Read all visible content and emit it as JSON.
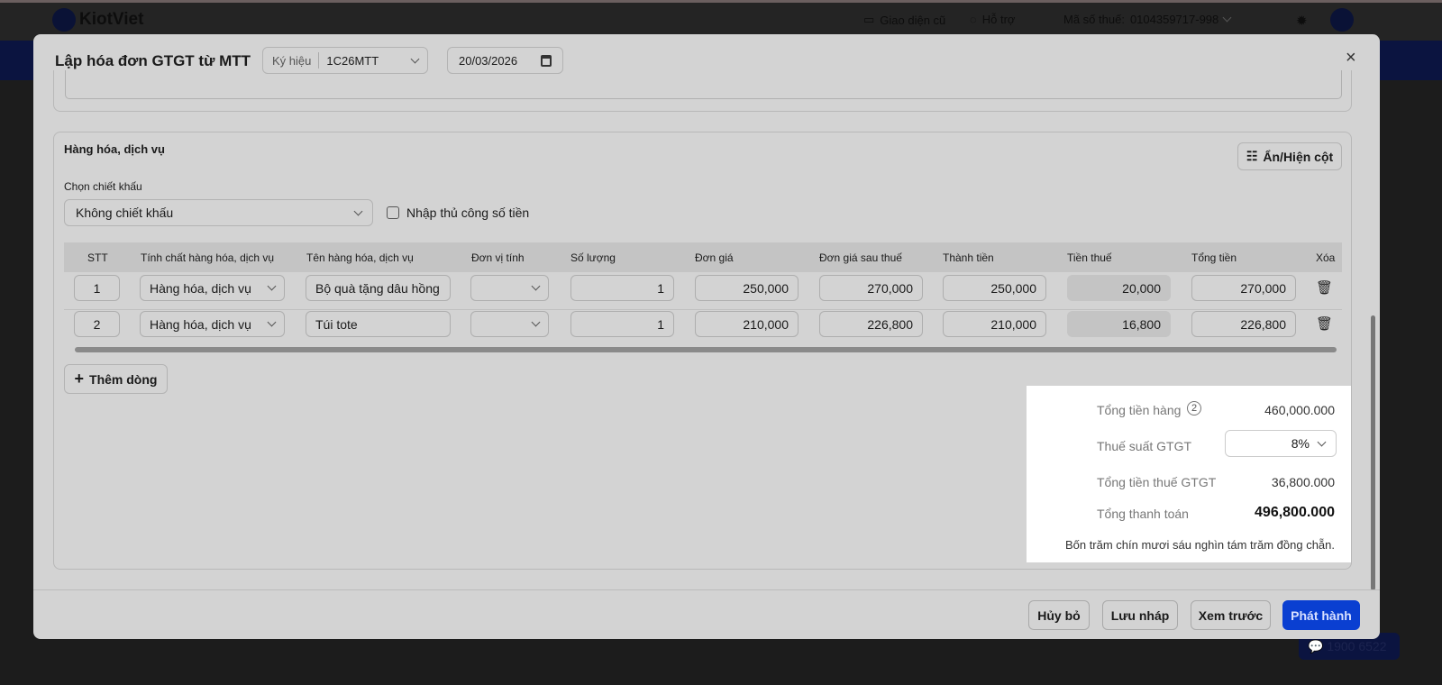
{
  "topbar": {
    "brand": "KiotViet",
    "old_ui": "Giao diện cũ",
    "support": "Hỗ trợ",
    "tax_code_label": "Mã số thuế:",
    "tax_code": "0104359717-998",
    "hotline": "1900 6522"
  },
  "modal": {
    "title": "Lập hóa đơn GTGT từ MTT",
    "symbol_label": "Ký hiệu",
    "symbol_value": "1C26MTT",
    "date": "20/03/2026",
    "close": "×"
  },
  "goods": {
    "title": "Hàng hóa, dịch vụ",
    "toggle_columns": "Ẩn/Hiện cột",
    "discount_label": "Chọn chiết khấu",
    "discount_value": "Không chiết khấu",
    "manual_amount": "Nhập thủ công số tiền",
    "add_row": "Thêm dòng",
    "columns": [
      "STT",
      "Tính chất hàng hóa, dịch vụ",
      "Tên hàng hóa, dịch vụ",
      "Đơn vị tính",
      "Số lượng",
      "Đơn giá",
      "Đơn giá sau thuế",
      "Thành tiền",
      "Tiền thuế",
      "Tổng tiền",
      "Xóa"
    ],
    "rows": [
      {
        "stt": "1",
        "type": "Hàng hóa, dịch vụ",
        "name": "Bộ quà tặng dâu hồng",
        "unit": "",
        "qty": "1",
        "price": "250,000",
        "price_after_tax": "270,000",
        "amount": "250,000",
        "tax": "20,000",
        "total": "270,000"
      },
      {
        "stt": "2",
        "type": "Hàng hóa, dịch vụ",
        "name": "Túi tote",
        "unit": "",
        "qty": "1",
        "price": "210,000",
        "price_after_tax": "226,800",
        "amount": "210,000",
        "tax": "16,800",
        "total": "226,800"
      }
    ]
  },
  "summary": {
    "subtotal_label": "Tổng tiền hàng",
    "subtotal_count": "2",
    "subtotal": "460,000.000",
    "vat_rate_label": "Thuế suất GTGT",
    "vat_rate": "8%",
    "vat_amount_label": "Tổng tiền thuế GTGT",
    "vat_amount": "36,800.000",
    "grand_total_label": "Tổng thanh toán",
    "grand_total": "496,800.000",
    "in_words": "Bốn trăm chín mươi sáu nghìn tám trăm đồng chẵn."
  },
  "footer": {
    "cancel": "Hủy bỏ",
    "save_draft": "Lưu nháp",
    "preview": "Xem trước",
    "issue": "Phát hành"
  },
  "colors": {
    "primary": "#0a3fd1"
  }
}
